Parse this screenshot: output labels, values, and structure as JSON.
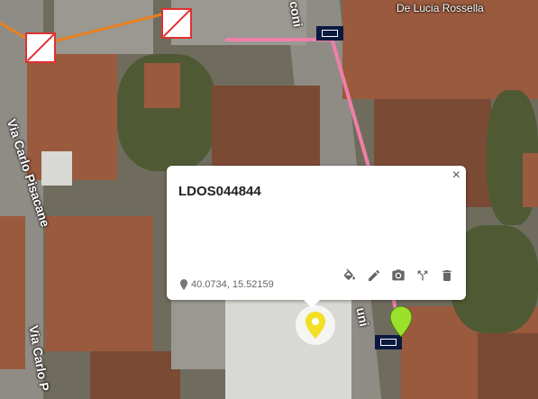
{
  "map": {
    "labels": {
      "via_carlo_pisacane_left": "Via Carlo Pisacane",
      "via_carlo_bottom": "Via Carlo P",
      "place_top": "De Lucia Rossella",
      "road_top_fragment": "coni",
      "road_bottom_fragment": "uni"
    },
    "colors": {
      "pink_line": "#f07fa8",
      "orange_line": "#e8811e",
      "selected_marker": "#f3e024",
      "green_marker": "#9be12c"
    }
  },
  "popup": {
    "title": "LDOS044844",
    "coords": "40.0734, 15.52159",
    "close_label": "×",
    "tools": [
      {
        "name": "fill-color-icon"
      },
      {
        "name": "edit-icon"
      },
      {
        "name": "camera-icon"
      },
      {
        "name": "directions-icon"
      },
      {
        "name": "delete-icon"
      }
    ]
  }
}
